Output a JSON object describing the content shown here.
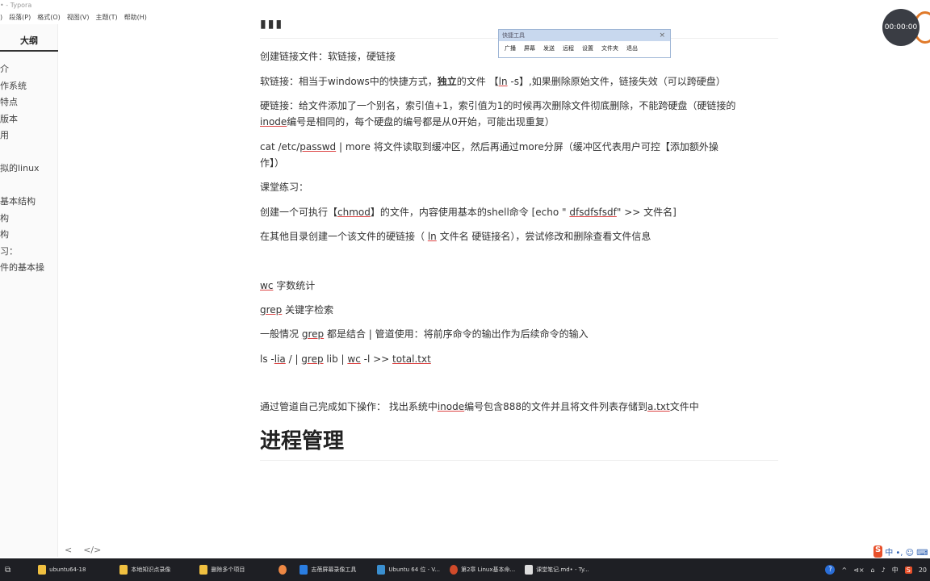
{
  "window": {
    "title": "• - Typora"
  },
  "menu": [
    "段落(P)",
    "格式(O)",
    "视图(V)",
    "主题(T)",
    "帮助(H)"
  ],
  "menu_prefix": ")",
  "sidebar": {
    "title": "大纲",
    "items": [
      "介",
      "作系统",
      "特点",
      "版本",
      "用",
      "",
      "拟的linux",
      "",
      "基本结构",
      "构",
      "构",
      "习：",
      "件的基本操"
    ]
  },
  "bottombar": {
    "back": "<",
    "source": "</>"
  },
  "content": {
    "top_heading": "▮▮▮",
    "p1": "创建链接文件：软链接，硬链接",
    "p2_a": "软链接：相当于windows中的快捷方式，",
    "p2_b": "独立",
    "p2_c": "的文件 【",
    "p2_d": "ln",
    "p2_e": " -s】,如果删除原始文件，链接失效（可以跨硬盘）",
    "p3_a": "硬链接：给文件添加了一个别名，索引值+1，索引值为1的时候再次删除文件彻底删除，不能跨硬盘（硬链接的",
    "p3_b": "inode",
    "p3_c": "编号是相同的，每个硬盘的编号都是从0开始，可能出现重复）",
    "p4_a": "cat /etc/",
    "p4_b": "passwd",
    "p4_c": " | more  将文件读取到缓冲区，然后再通过more分屏（缓冲区代表用户可控【添加额外操",
    "p4_d": "作】）",
    "p5": "课堂练习：",
    "p6_a": "创建一个可执行【",
    "p6_b": "chmod",
    "p6_c": "】的文件，内容使用基本的shell命令  [echo \"  ",
    "p6_d": "dfsdfsfsdf",
    "p6_e": "\" >> 文件名]",
    "p7_a": "在其他目录创建一个该文件的硬链接（ ",
    "p7_b": "ln",
    "p7_c": " 文件名  硬链接名），尝试修改和删除查看文件信息",
    "p8_a": "wc",
    "p8_b": "  字数统计",
    "p9_a": "grep",
    "p9_b": "  关键字检索",
    "p10_a": "一般情况 ",
    "p10_b": "grep",
    "p10_c": " 都是结合 | 管道使用：将前序命令的输出作为后续命令的输入",
    "p11_a": "ls -",
    "p11_b": "lia",
    "p11_c": " / | ",
    "p11_d": "grep",
    "p11_e": " lib | ",
    "p11_f": "wc",
    "p11_g": " -l  >> ",
    "p11_h": "total.txt",
    "p12_a": "通过管道自己完成如下操作：  找出系统中",
    "p12_b": "inode",
    "p12_c": "编号包含888的文件并且将文件列表存储到",
    "p12_d": "a.txt",
    "p12_e": "文件中",
    "h1": "进程管理"
  },
  "toolwin": {
    "title": "快捷工具",
    "close": "×",
    "buttons": [
      "广播",
      "屏幕",
      "发送",
      "远程",
      "设置",
      "文件夹",
      "退出"
    ]
  },
  "timer": {
    "time": "00:00:00"
  },
  "ime": {
    "logo": "S",
    "text": "中 •, ☺ ⌨"
  },
  "taskbar": {
    "items": [
      {
        "label": "ubuntu64-18",
        "color": "#f0c040"
      },
      {
        "label": "本地知识点录像",
        "color": "#f0c040"
      },
      {
        "label": "删除多个项目",
        "color": "#f0c040"
      },
      {
        "label": "",
        "color": "#e84"
      },
      {
        "label": "志蓓屏幕录像工具",
        "color": "#2a7de1"
      },
      {
        "label": "Ubuntu 64 位 - V...",
        "color": "#3a8fd0"
      },
      {
        "label": "第2章 Linux基本命...",
        "color": "#d04a2a"
      },
      {
        "label": "课堂笔记.md• - Ty...",
        "color": "#ddd"
      }
    ],
    "tray": [
      "?",
      "^",
      "⊲×",
      "⌂",
      "♪",
      "中",
      "S",
      "20"
    ]
  }
}
